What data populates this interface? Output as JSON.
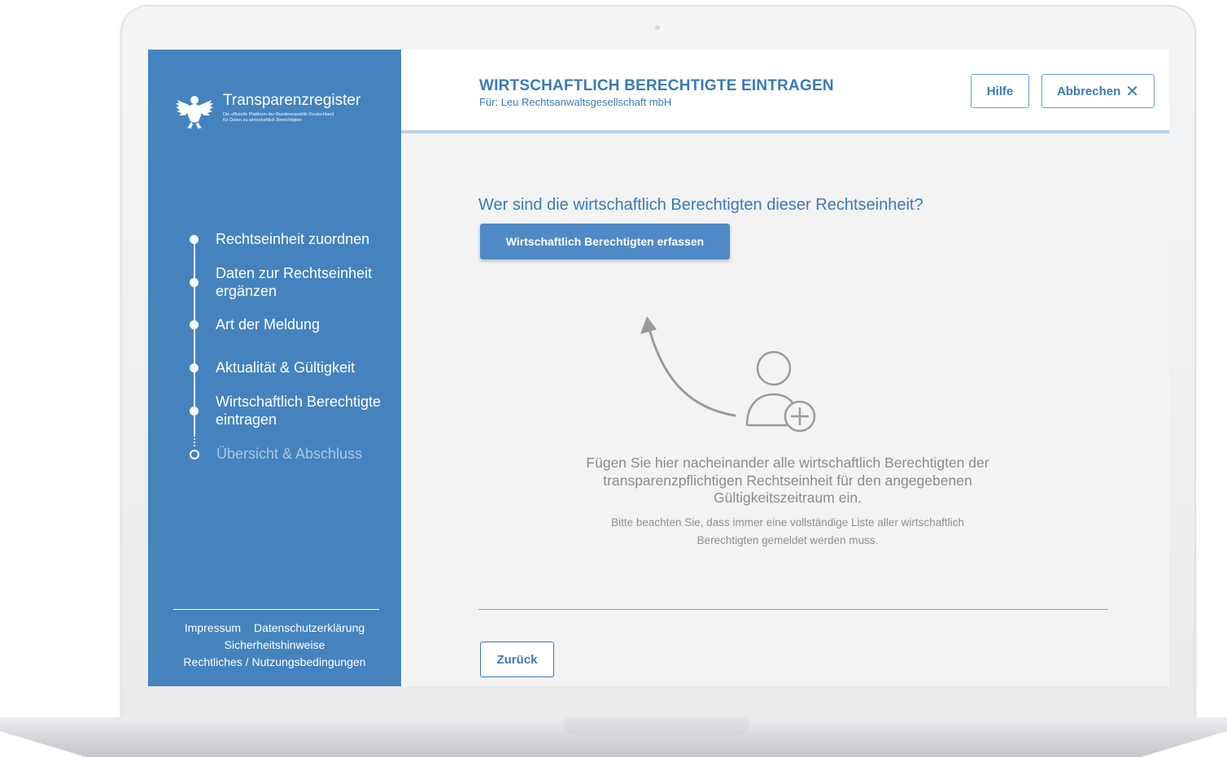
{
  "brand": {
    "title": "Transparenzregister",
    "subtitle_line1": "Die offizielle Plattform der Bundesrepublik Deutschland",
    "subtitle_line2": "für Daten zu wirtschaftlich Berechtigten"
  },
  "steps": [
    {
      "label": "Rechtseinheit zuordnen",
      "state": "done"
    },
    {
      "label": "Daten zur Rechtseinheit ergänzen",
      "state": "done"
    },
    {
      "label": "Art der Meldung",
      "state": "done"
    },
    {
      "label": "Aktualität & Gültigkeit",
      "state": "done"
    },
    {
      "label": "Wirtschaftlich Berechtigte eintragen",
      "state": "current"
    },
    {
      "label": "Übersicht & Abschluss",
      "state": "upcoming"
    }
  ],
  "footer": {
    "impressum": "Impressum",
    "datenschutz": "Datenschutzerklärung",
    "sicherheit": "Sicherheitshinweise",
    "rechtliches": "Rechtliches / Nutzungsbedingungen"
  },
  "header": {
    "title": "WIRTSCHAFTLICH BERECHTIGTE EINTRAGEN",
    "subtitle": "Für: Leu Rechtsanwaltsgesellschaft mbH",
    "help_label": "Hilfe",
    "cancel_label": "Abbrechen"
  },
  "main": {
    "question": "Wer sind die wirtschaftlich Berechtigten dieser Rechtseinheit?",
    "add_button": "Wirtschaftlich Berechtigten erfassen",
    "hint": "Fügen Sie hier nacheinander alle wirtschaftlich Berechtigten der transparenzpflichtigen Rechtseinheit für den angegebenen Gültigkeitszeitraum ein.",
    "note": "Bitte beachten Sie, dass immer eine vollständige Liste aller wirtschaftlich Berechtigten gemeldet werden muss.",
    "back_button": "Zurück"
  },
  "icons": {
    "logo": "federal-eagle-icon",
    "cancel": "close-icon",
    "illustration": "add-user-icon",
    "arrow": "curved-arrow-icon"
  },
  "colors": {
    "sidebar": "#4583bf",
    "accent": "#3b7ab8",
    "primary_button": "#4f8ac6",
    "content_bg": "#f3f3f3"
  }
}
